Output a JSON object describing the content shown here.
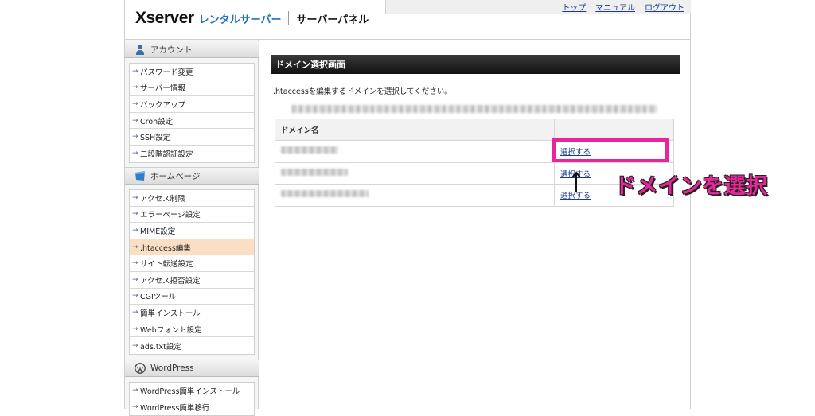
{
  "header": {
    "logo_x": "Xserver",
    "logo_rental": "レンタルサーバー",
    "logo_panel": "サーバーパネル",
    "nav": [
      "トップ",
      "マニュアル",
      "ログアウト"
    ]
  },
  "sidebar": {
    "account": {
      "title": "アカウント",
      "items": [
        "パスワード変更",
        "サーバー情報",
        "バックアップ",
        "Cron設定",
        "SSH設定",
        "二段階認証設定"
      ]
    },
    "homepage": {
      "title": "ホームページ",
      "items": [
        "アクセス制限",
        "エラーページ設定",
        "MIME設定",
        ".htaccess編集",
        "サイト転送設定",
        "アクセス拒否設定",
        "CGIツール",
        "簡単インストール",
        "Webフォント設定",
        "ads.txt設定"
      ],
      "active_index": 3
    },
    "wordpress": {
      "title": "WordPress",
      "items": [
        "WordPress簡単インストール",
        "WordPress簡単移行"
      ]
    }
  },
  "main": {
    "title": "ドメイン選択画面",
    "instruction": ".htaccessを編集するドメインを選択してください。",
    "table": {
      "header": "ドメイン名",
      "rows": [
        {
          "link": "選択する"
        },
        {
          "link": "選択する"
        },
        {
          "link": "選択する"
        }
      ]
    }
  },
  "annotation": {
    "text": "ドメインを選択",
    "color": "#e8259b"
  }
}
